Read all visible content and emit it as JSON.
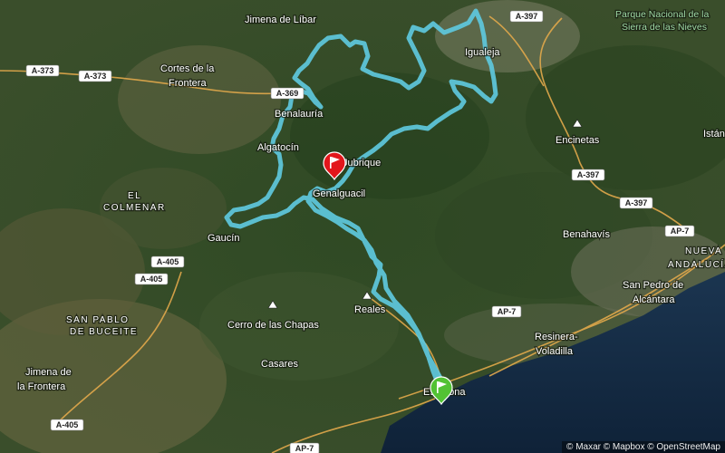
{
  "map": {
    "places": [
      {
        "id": "jimena-de-libar",
        "text": "Jimena de Líbar"
      },
      {
        "id": "parque-nacional-line1",
        "text": "Parque Nacional de la"
      },
      {
        "id": "parque-nacional-line2",
        "text": "Sierra de las Nieves"
      },
      {
        "id": "cortes-line1",
        "text": "Cortes de la"
      },
      {
        "id": "cortes-line2",
        "text": "Frontera"
      },
      {
        "id": "igualeja",
        "text": "Igualeja"
      },
      {
        "id": "benalauria",
        "text": "Benalauría"
      },
      {
        "id": "algatocin",
        "text": "Algatocín"
      },
      {
        "id": "jubrique",
        "text": "Jubrique"
      },
      {
        "id": "genalguacil",
        "text": "Genalguacil"
      },
      {
        "id": "encinetas",
        "text": "Encinetas"
      },
      {
        "id": "istan",
        "text": "Istán"
      },
      {
        "id": "el-colmenar-line1",
        "text": "EL"
      },
      {
        "id": "el-colmenar-line2",
        "text": "COLMENAR"
      },
      {
        "id": "gaucin",
        "text": "Gaucín"
      },
      {
        "id": "benahavis",
        "text": "Benahavís"
      },
      {
        "id": "nueva-andalucia-line1",
        "text": "NUEVA"
      },
      {
        "id": "nueva-andalucia-line2",
        "text": "ANDALUCÍA"
      },
      {
        "id": "san-pedro-line1",
        "text": "San Pedro de"
      },
      {
        "id": "san-pedro-line2",
        "text": "Alcántara"
      },
      {
        "id": "san-pablo-line1",
        "text": "SAN PABLO"
      },
      {
        "id": "san-pablo-line2",
        "text": "DE BUCEITE"
      },
      {
        "id": "cerro-chapas",
        "text": "Cerro de las Chapas"
      },
      {
        "id": "reales",
        "text": "Reales"
      },
      {
        "id": "resinera-line1",
        "text": "Resinera-"
      },
      {
        "id": "resinera-line2",
        "text": "Voladilla"
      },
      {
        "id": "casares",
        "text": "Casares"
      },
      {
        "id": "jimena-line1",
        "text": "Jimena de"
      },
      {
        "id": "jimena-line2",
        "text": "la Frontera"
      },
      {
        "id": "estepona",
        "text": "Estepona"
      }
    ],
    "roads": [
      {
        "id": "a397-top",
        "text": "A-397"
      },
      {
        "id": "a373-left",
        "text": "A-373"
      },
      {
        "id": "a373-right",
        "text": "A-373"
      },
      {
        "id": "a369",
        "text": "A-369"
      },
      {
        "id": "a397-mid",
        "text": "A-397"
      },
      {
        "id": "a397-low",
        "text": "A-397"
      },
      {
        "id": "ap7-right",
        "text": "AP-7"
      },
      {
        "id": "a405-top",
        "text": "A-405"
      },
      {
        "id": "a405-mid",
        "text": "A-405"
      },
      {
        "id": "ap7-center",
        "text": "AP-7"
      },
      {
        "id": "a405-bottom",
        "text": "A-405"
      },
      {
        "id": "ap7-bottom",
        "text": "AP-7"
      }
    ],
    "route_color": "#5ec8dd",
    "start_marker": {
      "icon": "flag-icon",
      "color": "#e3161b"
    },
    "end_marker": {
      "icon": "flag-icon",
      "color": "#52c234"
    },
    "attribution": "© Maxar © Mapbox © OpenStreetMap"
  }
}
